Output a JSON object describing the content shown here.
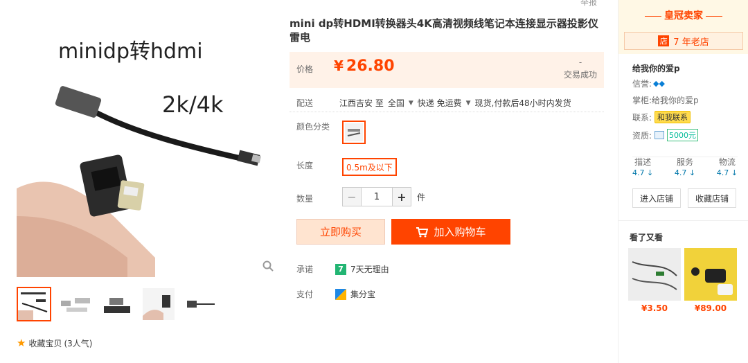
{
  "gallery": {
    "main_image_text_1": "minidp转hdmi",
    "main_image_text_2": "2k/4k",
    "favorite_label": "收藏宝贝",
    "favorite_count": "(3人气)"
  },
  "info": {
    "report_label": "举报",
    "title": "mini dp转HDMI转换器头4K高清视频线笔记本连接显示器投影仪雷电",
    "price_label": "价格",
    "price_currency": "¥",
    "price": "26.80",
    "deal_count": "-",
    "deal_label": "交易成功",
    "delivery_label": "配送",
    "delivery_from": "江西吉安 至",
    "delivery_to": "全国",
    "delivery_method": "快递 免运费",
    "delivery_note": "现货,付款后48小时内发货",
    "color_label": "颜色分类",
    "length_label": "长度",
    "length_value": "0.5m及以下",
    "qty_label": "数量",
    "qty_value": "1",
    "qty_unit": "件",
    "buy_now_label": "立即购买",
    "add_cart_label": "加入购物车",
    "promise_label": "承诺",
    "promise_value": "7天无理由",
    "payment_label": "支付",
    "payment_value": "集分宝"
  },
  "shop": {
    "badge": "皇冠卖家",
    "years": "7 年老店",
    "name": "给我你的爱p",
    "credit_label": "信誉:",
    "owner_label": "掌柜:",
    "owner": "给我你的爱p",
    "contact_label": "联系:",
    "contact_btn": "和我联系",
    "cert_label": "资质:",
    "deposit": "5000元",
    "scores": [
      {
        "label": "描述",
        "value": "4.7"
      },
      {
        "label": "服务",
        "value": "4.7"
      },
      {
        "label": "物流",
        "value": "4.7"
      }
    ],
    "enter_shop": "进入店铺",
    "fav_shop": "收藏店铺",
    "rec_title": "看了又看",
    "recs": [
      {
        "price": "¥3.50"
      },
      {
        "price": "¥89.00"
      }
    ]
  },
  "colors": {
    "accent": "#ff4400",
    "price_bg": "#fff2e8"
  }
}
